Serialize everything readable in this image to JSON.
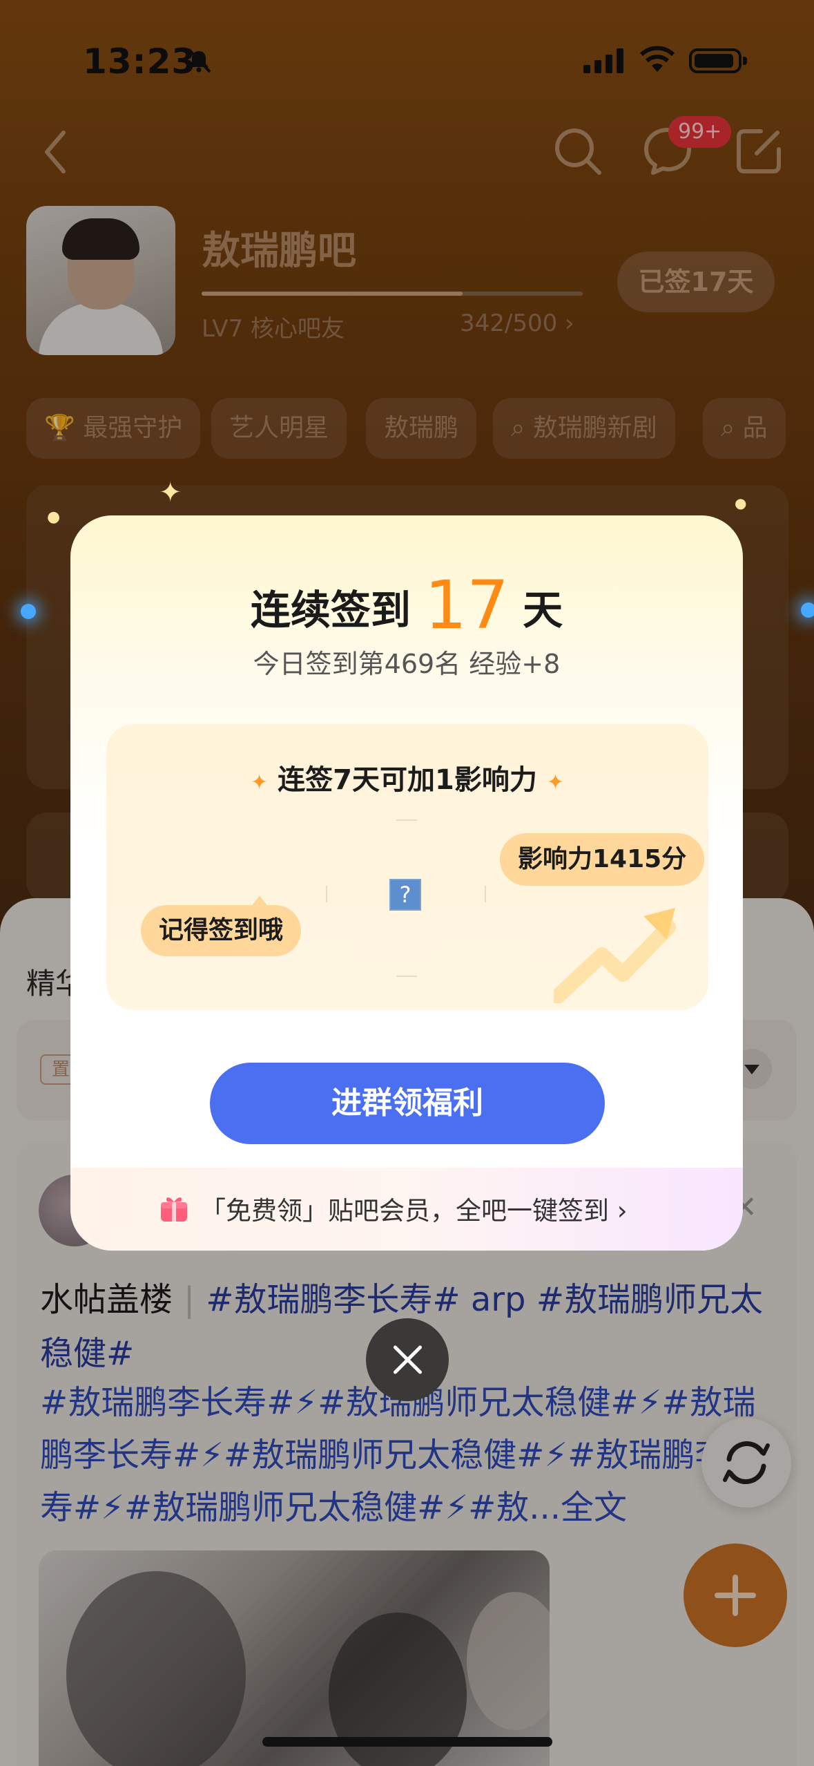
{
  "status_bar": {
    "time": "13:23"
  },
  "nav": {
    "message_badge": "99+"
  },
  "forum": {
    "name": "敖瑞鹏吧",
    "level": "LV7 核心吧友",
    "exp": "342/500 ›",
    "exp_progress": 0.684,
    "signed_label": "已签17天"
  },
  "tags": [
    {
      "label": "最强守护",
      "icon": "trophy-icon"
    },
    {
      "label": "艺人明星"
    },
    {
      "label": "敖瑞鹏"
    },
    {
      "label": "敖瑞鹏新剧",
      "icon": "search-icon"
    },
    {
      "label": "品",
      "icon": "search-icon"
    }
  ],
  "content": {
    "section_title": "精华",
    "pin_badge": "置",
    "post": {
      "title_prefix": "水帖盖楼",
      "title_tags": "#敖瑞鹏李长寿# arp #敖瑞鹏师兄太稳健#",
      "body": "#敖瑞鹏李长寿#⚡#敖瑞鹏师兄太稳健#⚡#敖瑞鹏李长寿#⚡#敖瑞鹏师兄太稳健#⚡#敖瑞鹏李长寿#⚡#敖瑞鹏师兄太稳健#⚡#敖...全文"
    }
  },
  "modal": {
    "title_prefix": "连续签到",
    "streak_days": "17",
    "title_suffix": "天",
    "subtitle": "今日签到第469名 经验+8",
    "progress_heading": "连签7天可加1影响力",
    "influence_bubble": "影响力1415分",
    "reminder_bubble": "记得签到哦",
    "center_image_glyph": "?",
    "cta_label": "进群领福利",
    "vip_text": "「免费领」贴吧会员，全吧一键签到 ›"
  },
  "colors": {
    "accent_orange": "#ff8a14",
    "cta_blue": "#4a6ff0",
    "badge_red": "#e8343a",
    "hashtag_blue": "#3049b8"
  }
}
